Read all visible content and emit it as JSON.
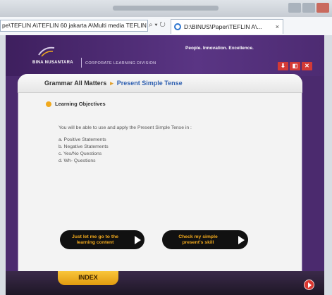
{
  "browser": {
    "address": "pe\\TEFLIN A\\TEFLIN 60 jakarta A\\Multi media TEFLIN",
    "address_icons": "⌕ ▾ ↻",
    "tab_title": "D:\\BINUS\\Paper\\TEFLIN A\\...",
    "tab_close": "×"
  },
  "header": {
    "logo_text": "BINA NUSANTARA",
    "division": "CORPORATE LEARNING DIVISION",
    "tagline": "People. Innovation. Excellence.",
    "buttons": [
      "⬇",
      "◧",
      "✕"
    ]
  },
  "breadcrumb": {
    "root": "Grammar All Matters",
    "separator": "▸",
    "current": "Present Simple Tense"
  },
  "objectives": {
    "title": "Learning Objectives",
    "intro": "You will be able to use and apply the Present Simple Tense in :",
    "items": [
      "a. Positive  Statements",
      "b. Negative Statements",
      "c. Yes/No Questions",
      "d. Wh- Questions"
    ]
  },
  "buttons": {
    "learning_line1": "Just let me go to the",
    "learning_line2": "learning content",
    "skill_line1": "Check my simple",
    "skill_line2": "present's skill"
  },
  "footer": {
    "index_label": "INDEX"
  },
  "colors": {
    "app_purple": "#4b2a6e",
    "accent_orange": "#f1a91d",
    "link_blue": "#2e5fb0",
    "alert_red": "#d33a36"
  }
}
